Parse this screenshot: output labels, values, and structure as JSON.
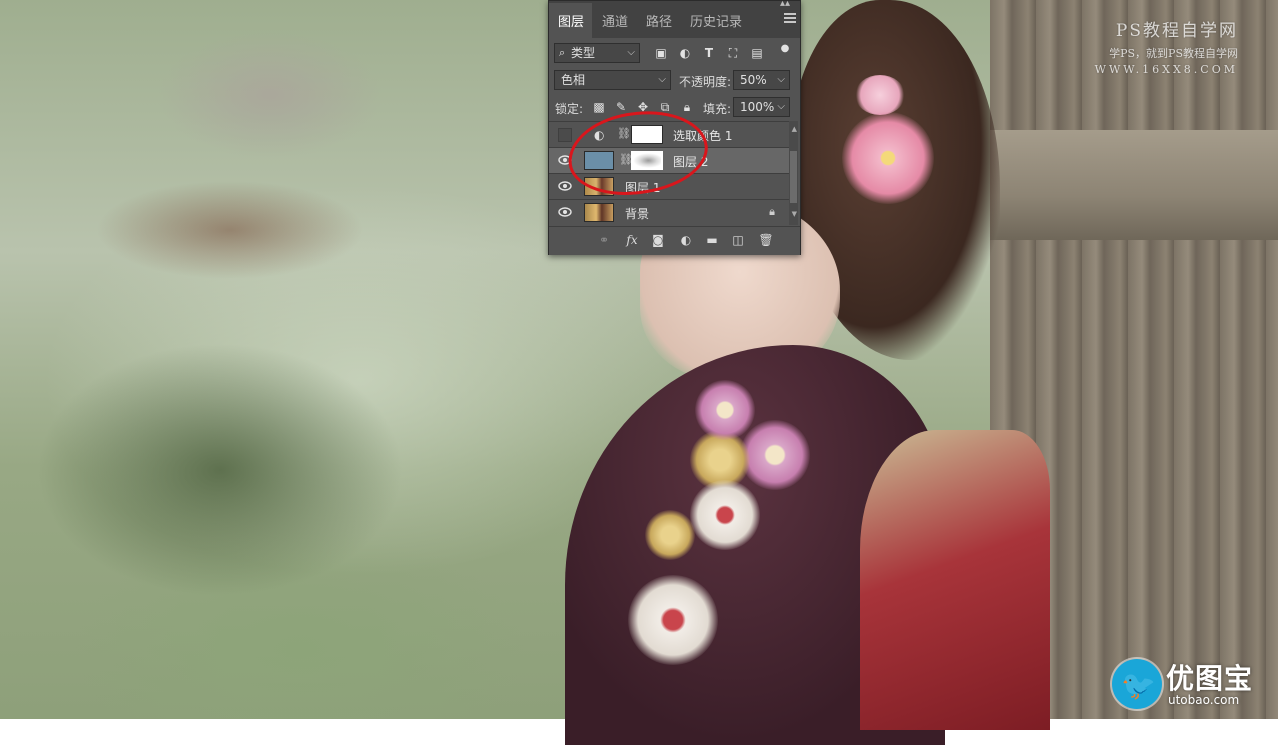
{
  "panel": {
    "tabs": [
      {
        "label": "图层",
        "active": true
      },
      {
        "label": "通道",
        "active": false
      },
      {
        "label": "路径",
        "active": false
      },
      {
        "label": "历史记录",
        "active": false
      }
    ],
    "filter": {
      "label": "类型"
    },
    "blend_mode": "色相",
    "opacity_label": "不透明度:",
    "opacity_value": "50%",
    "lock_label": "锁定:",
    "fill_label": "填充:",
    "fill_value": "100%",
    "layers": [
      {
        "name": "选取颜色 1",
        "visible": false,
        "type": "adjustment"
      },
      {
        "name": "图层 2",
        "visible": true,
        "selected": true,
        "type": "masked"
      },
      {
        "name": "图层 1",
        "visible": true,
        "type": "image"
      },
      {
        "name": "背景",
        "visible": true,
        "locked": true,
        "type": "image"
      }
    ],
    "thumb_color_layer2": "#6b8fa8",
    "annotation_color": "#d9161c"
  },
  "watermark_top": {
    "title": "PS教程自学网",
    "subtitle": "学PS，就到PS教程自学网",
    "url": "WWW.16XX8.COM"
  },
  "watermark_bottom": {
    "name": "优图宝",
    "url": "utobao.com"
  }
}
